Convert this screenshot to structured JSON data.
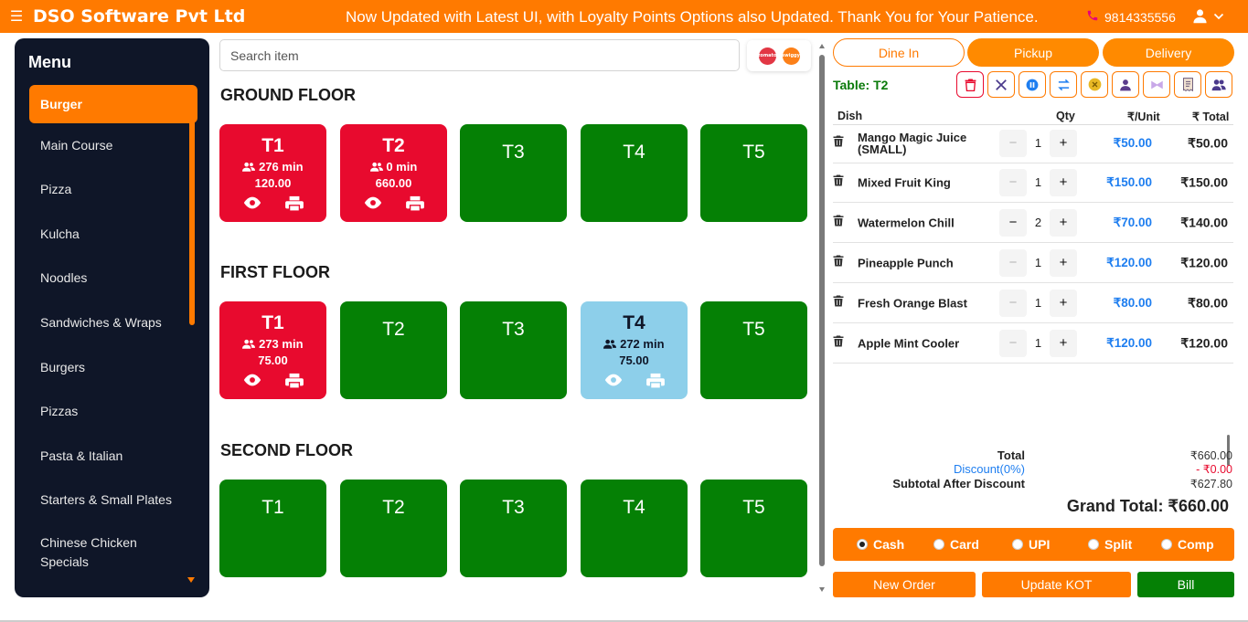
{
  "header": {
    "brand": "DSO Software Pvt Ltd",
    "announcement": "Now Updated with Latest UI, with Loyalty Points Options also Updated. Thank You for Your Patience.",
    "phone": "9814335556",
    "accent": "#ff7a00"
  },
  "sidebar": {
    "title": "Menu",
    "items": [
      {
        "label": "Burger"
      },
      {
        "label": "Main Course"
      },
      {
        "label": "Pizza"
      },
      {
        "label": "Kulcha"
      },
      {
        "label": "Noodles"
      },
      {
        "label": "Sandwiches & Wraps"
      },
      {
        "label": "Burgers"
      },
      {
        "label": "Pizzas"
      },
      {
        "label": "Pasta & Italian"
      },
      {
        "label": "Starters & Small Plates"
      },
      {
        "label": "Chinese Chicken Specials"
      }
    ]
  },
  "search": {
    "placeholder": "Search item"
  },
  "delivery_partners": [
    {
      "name": "zomato-logo",
      "color": "#e23744"
    },
    {
      "name": "swiggy-logo",
      "color": "#fc8019"
    }
  ],
  "floors": [
    {
      "title": "GROUND FLOOR",
      "tables": [
        {
          "name": "T1",
          "status": "busy",
          "time": "276 min",
          "amount": "120.00"
        },
        {
          "name": "T2",
          "status": "busy",
          "time": "0 min",
          "amount": "660.00"
        },
        {
          "name": "T3",
          "status": "free"
        },
        {
          "name": "T4",
          "status": "free"
        },
        {
          "name": "T5",
          "status": "free"
        }
      ]
    },
    {
      "title": "FIRST FLOOR",
      "tables": [
        {
          "name": "T1",
          "status": "busy",
          "time": "273 min",
          "amount": "75.00"
        },
        {
          "name": "T2",
          "status": "free"
        },
        {
          "name": "T3",
          "status": "free"
        },
        {
          "name": "T4",
          "status": "print",
          "time": "272 min",
          "amount": "75.00"
        },
        {
          "name": "T5",
          "status": "free"
        }
      ]
    },
    {
      "title": "SECOND FLOOR",
      "tables": [
        {
          "name": "T1",
          "status": "free"
        },
        {
          "name": "T2",
          "status": "free"
        },
        {
          "name": "T3",
          "status": "free"
        },
        {
          "name": "T4",
          "status": "free"
        },
        {
          "name": "T5",
          "status": "free"
        }
      ]
    }
  ],
  "status_colors": {
    "free": "#058005",
    "busy": "#e80a2e",
    "print": "#8dcfea"
  },
  "order": {
    "tabs": [
      {
        "label": "Dine In",
        "selected": true
      },
      {
        "label": "Pickup",
        "selected": false
      },
      {
        "label": "Delivery",
        "selected": false
      }
    ],
    "table_label": "Table: T2",
    "actions": [
      {
        "icon": "trash-icon"
      },
      {
        "icon": "close-icon"
      },
      {
        "icon": "pause-icon"
      },
      {
        "icon": "swap-icon"
      },
      {
        "icon": "coin-icon"
      },
      {
        "icon": "user-icon"
      },
      {
        "icon": "merge-icon"
      },
      {
        "icon": "receipt-icon"
      },
      {
        "icon": "users-icon"
      }
    ],
    "columns": {
      "dish": "Dish",
      "qty": "Qty",
      "unit": "₹/Unit",
      "total": "₹ Total"
    },
    "items": [
      {
        "dish": "Mango Magic Juice (SMALL)",
        "qty": "1",
        "unit": "₹50.00",
        "total": "₹50.00"
      },
      {
        "dish": "Mixed Fruit King",
        "qty": "1",
        "unit": "₹150.00",
        "total": "₹150.00"
      },
      {
        "dish": "Watermelon Chill",
        "qty": "2",
        "unit": "₹70.00",
        "total": "₹140.00"
      },
      {
        "dish": "Pineapple Punch",
        "qty": "1",
        "unit": "₹120.00",
        "total": "₹120.00"
      },
      {
        "dish": "Fresh Orange Blast",
        "qty": "1",
        "unit": "₹80.00",
        "total": "₹80.00"
      },
      {
        "dish": "Apple Mint Cooler",
        "qty": "1",
        "unit": "₹120.00",
        "total": "₹120.00"
      }
    ],
    "summary": {
      "total_label": "Total",
      "total_value": "₹660.00",
      "discount_label": "Discount(0%)",
      "discount_value": "- ₹0.00",
      "subtotal_label": "Subtotal After Discount",
      "subtotal_value": "₹627.80",
      "grand_total": "Grand Total: ₹660.00"
    },
    "payment": [
      {
        "label": "Cash",
        "checked": true
      },
      {
        "label": "Card",
        "checked": false
      },
      {
        "label": "UPI",
        "checked": false
      },
      {
        "label": "Split",
        "checked": false
      },
      {
        "label": "Comp",
        "checked": false
      }
    ],
    "buttons": {
      "new_order": "New Order",
      "update_kot": "Update KOT",
      "bill": "Bill"
    }
  }
}
